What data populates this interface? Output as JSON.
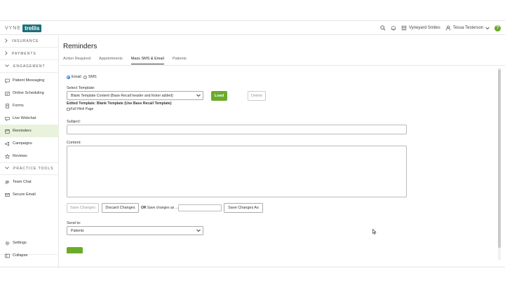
{
  "brand": {
    "vyne": "VYNE",
    "trellis": "trellis"
  },
  "header": {
    "practice_name": "Vyneyard Smiles",
    "user_name": "Tessa Testerson",
    "help_label": "?"
  },
  "sidebar": {
    "sections": [
      {
        "label": "INSURANCE"
      },
      {
        "label": "PAYMENTS"
      },
      {
        "label": "ENGAGEMENT"
      },
      {
        "label": "PRACTICE TOOLS"
      }
    ],
    "items": [
      {
        "label": "Patient Messaging",
        "icon": "message-icon"
      },
      {
        "label": "Online Scheduling",
        "icon": "calendar-check-icon"
      },
      {
        "label": "Forms",
        "icon": "form-icon"
      },
      {
        "label": "Live Webchat",
        "icon": "chat-icon"
      },
      {
        "label": "Reminders",
        "icon": "calendar-icon"
      },
      {
        "label": "Campaigns",
        "icon": "megaphone-icon"
      },
      {
        "label": "Reviews",
        "icon": "star-icon"
      },
      {
        "label": "Team Chat",
        "icon": "team-icon"
      },
      {
        "label": "Secure Email",
        "icon": "email-icon"
      },
      {
        "label": "Settings",
        "icon": "gear-icon"
      },
      {
        "label": "Collapse",
        "icon": "collapse-icon"
      }
    ],
    "active_item": "Reminders"
  },
  "page": {
    "title": "Reminders",
    "tabs": [
      {
        "label": "Action Required"
      },
      {
        "label": "Appointments"
      },
      {
        "label": "Mass SMS & Email"
      },
      {
        "label": "Patients"
      }
    ],
    "active_tab": "Mass SMS & Email"
  },
  "form": {
    "channel_email": "Email",
    "channel_sms": "SMS",
    "selected_channel": "Email",
    "select_template_label": "Select Template:",
    "template_value": "Blank Template Content (Base Recall header and footer added)",
    "load_button": "Load",
    "delete_button": "Delete",
    "edited_template": "Edited Template: Blank Template (Use Base Recall Template)",
    "full_html_label": "Full Html Page",
    "subject_label": "Subject:",
    "subject_value": "",
    "content_label": "Content:",
    "content_value": "",
    "save_changes_button": "Save Changes",
    "discard_changes_button": "Discard Changes",
    "or_label": "OR",
    "save_as_label": "Save changes as ...",
    "save_as_value": "",
    "save_changes_as_button": "Save Changes As",
    "send_to_label": "Send to:",
    "send_to_value": "Patients"
  },
  "colors": {
    "brand_teal": "#1b6f7b",
    "accent_green": "#6aab2a",
    "active_sidebar_bg": "#e9f2dc",
    "radio_blue": "#1e6fd9"
  }
}
